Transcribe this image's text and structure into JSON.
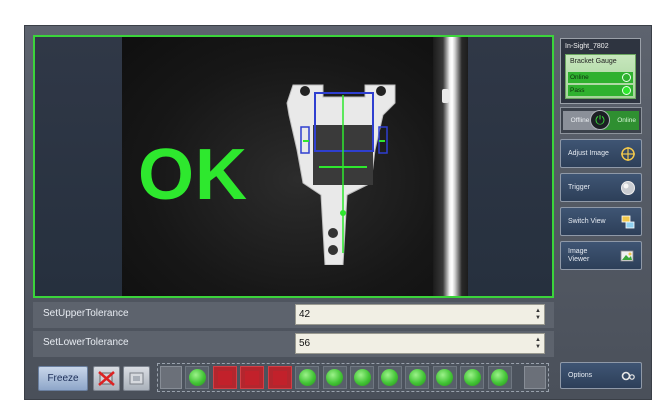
{
  "viewer": {
    "result_text": "OK",
    "result_color": "#2ee82e"
  },
  "params": [
    {
      "label": "SetUpperTolerance",
      "value": "42"
    },
    {
      "label": "SetLowerTolerance",
      "value": "56"
    }
  ],
  "toolbar": {
    "freeze_label": "Freeze"
  },
  "filmstrip": {
    "slots": [
      "pass",
      "fail",
      "fail",
      "fail",
      "pass",
      "pass",
      "pass",
      "pass",
      "pass",
      "pass",
      "pass",
      "pass"
    ]
  },
  "right_panel": {
    "sensor_name": "In-Sight_7802",
    "job_name": "Bracket Gauge",
    "online_status": "Online",
    "pass_status": "Pass",
    "toggle_off_label": "Offline",
    "toggle_on_label": "Online",
    "buttons": [
      {
        "label": "Adjust Image",
        "icon": "crosshair-icon"
      },
      {
        "label": "Trigger",
        "icon": "trigger-icon"
      },
      {
        "label": "Switch View",
        "icon": "switch-view-icon"
      },
      {
        "label": "Image Viewer",
        "icon": "image-viewer-icon"
      }
    ],
    "options_label": "Options"
  },
  "colors": {
    "accent_green": "#3bd43b",
    "fail_red": "#c2212b",
    "panel_blue": "#3f5574"
  }
}
